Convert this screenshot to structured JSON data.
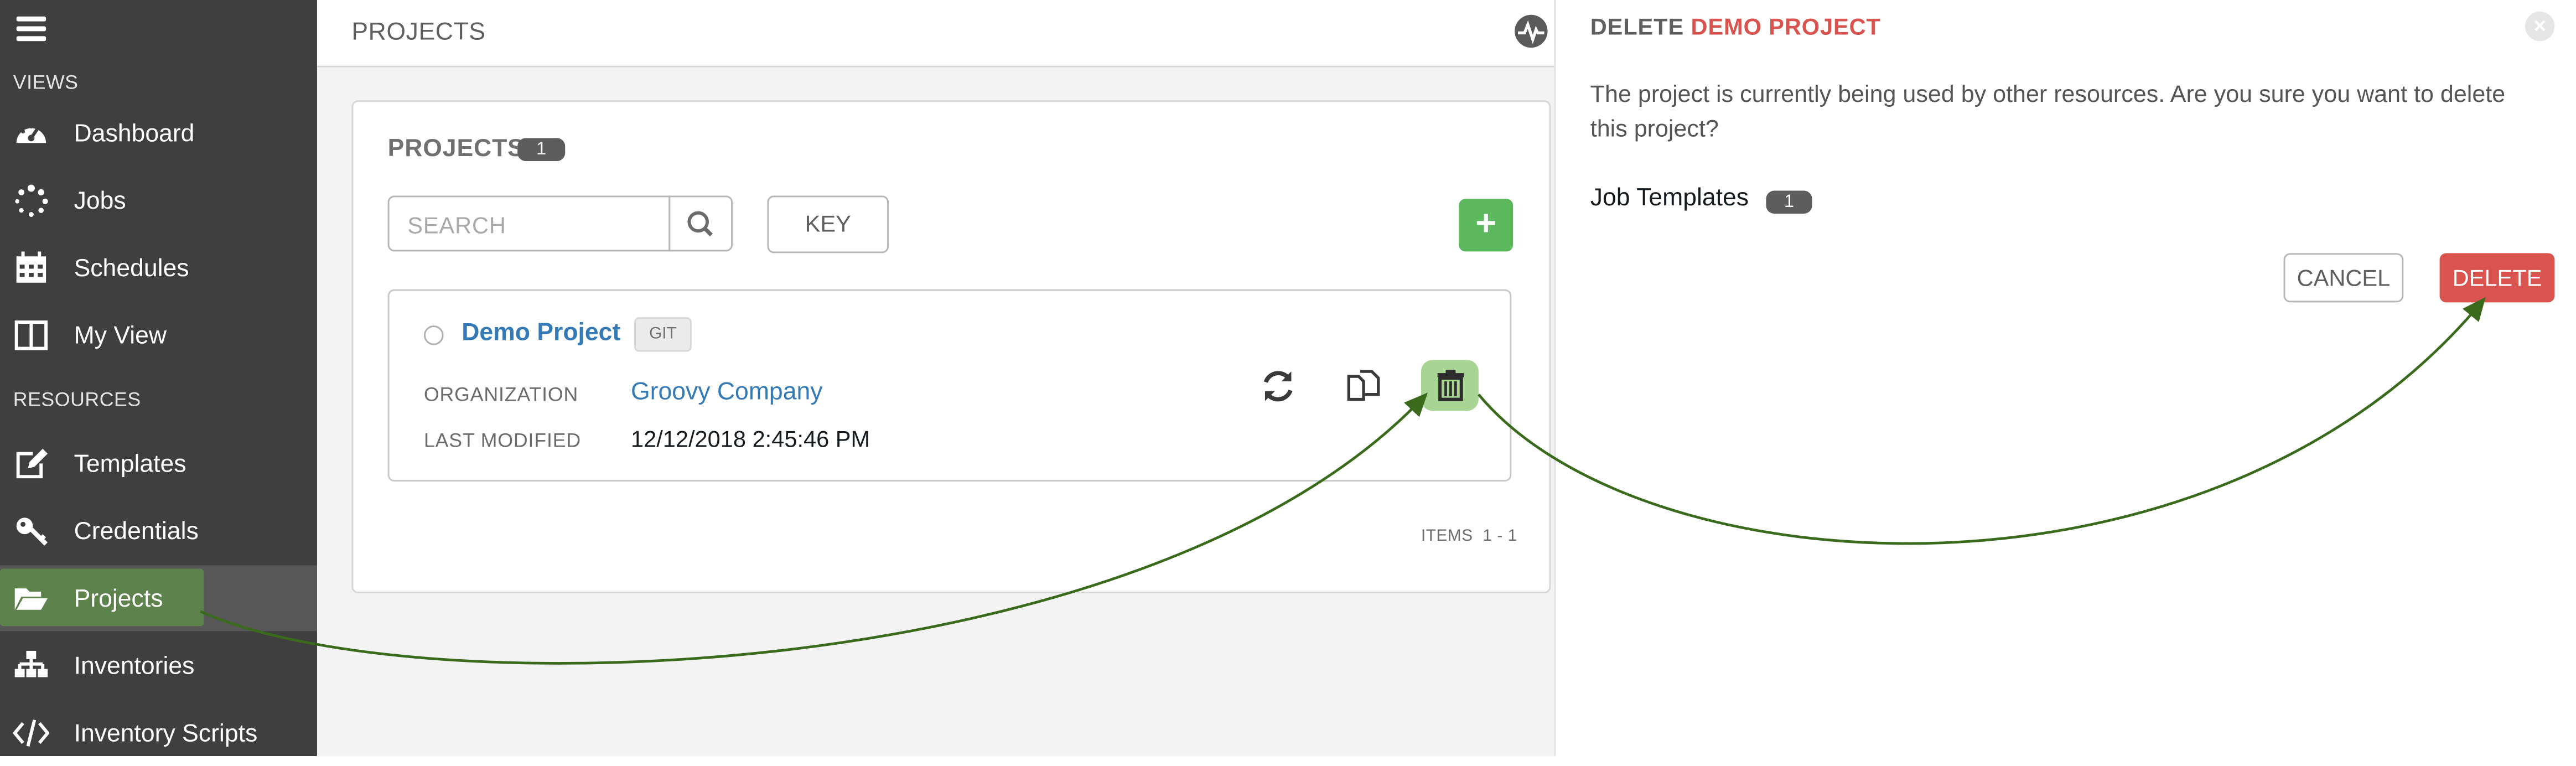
{
  "sidebar": {
    "views_label": "VIEWS",
    "resources_label": "RESOURCES",
    "items": [
      {
        "label": "Dashboard",
        "icon": "tachometer-icon"
      },
      {
        "label": "Jobs",
        "icon": "spinner-icon"
      },
      {
        "label": "Schedules",
        "icon": "calendar-icon"
      },
      {
        "label": "My View",
        "icon": "columns-icon"
      },
      {
        "label": "Templates",
        "icon": "pencil-square-icon"
      },
      {
        "label": "Credentials",
        "icon": "key-icon"
      },
      {
        "label": "Projects",
        "icon": "folder-open-icon",
        "active": true
      },
      {
        "label": "Inventories",
        "icon": "sitemap-icon"
      },
      {
        "label": "Inventory Scripts",
        "icon": "code-icon"
      }
    ]
  },
  "header": {
    "breadcrumb": "PROJECTS"
  },
  "projects_panel": {
    "title": "PROJECTS",
    "count": "1",
    "search_placeholder": "SEARCH",
    "key_label": "KEY",
    "add_label": "+",
    "items_label": "ITEMS",
    "items_range": "1 - 1"
  },
  "project": {
    "name": "Demo Project",
    "scm_type": "GIT",
    "organization_label": "ORGANIZATION",
    "organization": "Groovy Company",
    "last_modified_label": "LAST MODIFIED",
    "last_modified": "12/12/2018 2:45:46 PM"
  },
  "dialog": {
    "title_prefix": "DELETE",
    "title_name": "DEMO PROJECT",
    "message": "The project is currently being used by other resources. Are you sure you want to delete this project?",
    "resource_label": "Job Templates",
    "resource_count": "1",
    "cancel_label": "CANCEL",
    "delete_label": "DELETE"
  },
  "colors": {
    "sidebar_bg": "#3f3f3f",
    "link": "#337ab7",
    "add_button": "#5cb85c",
    "danger": "#d9534f",
    "annotation_arrow": "#3a6b1c",
    "highlight": "#a8d594"
  }
}
